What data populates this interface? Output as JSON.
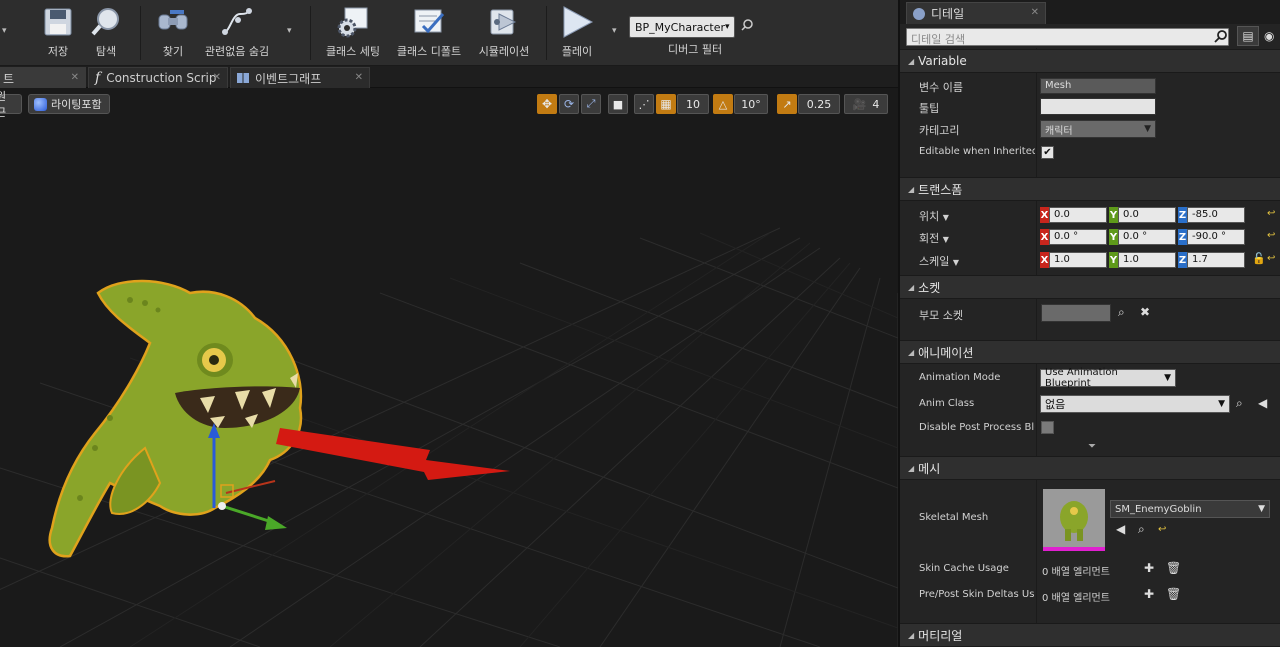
{
  "toolbar": {
    "buttons": [
      {
        "label": "저장",
        "icon": "save-icon"
      },
      {
        "label": "탐색",
        "icon": "browse-icon"
      },
      {
        "label": "찾기",
        "icon": "find-icon"
      },
      {
        "label": "관련없음 숨김",
        "icon": "hide-unrelated-icon"
      },
      {
        "label": "클래스 세팅",
        "icon": "class-settings-icon"
      },
      {
        "label": "클래스 디폴트",
        "icon": "class-defaults-icon"
      },
      {
        "label": "시뮬레이션",
        "icon": "simulation-icon"
      },
      {
        "label": "플레이",
        "icon": "play-icon"
      }
    ],
    "debug_object": "BP_MyCharacter",
    "debug_filter_label": "디버그 필터"
  },
  "tabs": [
    {
      "label": "트"
    },
    {
      "label": "Construction Scrip"
    },
    {
      "label": "이벤트그래프"
    }
  ],
  "viewport": {
    "left_pills": [
      "원근",
      "라이팅포함"
    ],
    "grid_snap": "10",
    "rotation_snap": "10°",
    "scale_snap": "0.25",
    "camera_speed": "4"
  },
  "panel": {
    "tab_label": "디테일",
    "search_placeholder": "디테일 검색",
    "variable": {
      "header": "Variable",
      "name_label": "변수 이름",
      "name_value": "Mesh",
      "tooltip_label": "툴팁",
      "category_label": "카테고리",
      "category_value": "캐릭터",
      "editable_label": "Editable when Inherited"
    },
    "transform": {
      "header": "트랜스폼",
      "location_label": "위치",
      "location": [
        "0.0",
        "0.0",
        "-85.0"
      ],
      "rotation_label": "회전",
      "rotation": [
        "0.0 °",
        "0.0 °",
        "-90.0 °"
      ],
      "scale_label": "스케일",
      "scale": [
        "1.0",
        "1.0",
        "1.7"
      ]
    },
    "socket": {
      "header": "소켓",
      "parent_label": "부모 소켓"
    },
    "animation": {
      "header": "애니메이션",
      "mode_label": "Animation Mode",
      "mode_value": "Use Animation Blueprint",
      "class_label": "Anim Class",
      "class_value": "없음",
      "disable_pp_label": "Disable Post Process Blu"
    },
    "mesh": {
      "header": "메시",
      "skeletal_label": "Skeletal Mesh",
      "skeletal_value": "SM_EnemyGoblin",
      "skin_cache_label": "Skin Cache Usage",
      "skin_cache_value": "0 배열 엘리먼트",
      "skin_deltas_label": "Pre/Post Skin Deltas Usa",
      "skin_deltas_value": "0 배열 엘리먼트"
    },
    "material": {
      "header": "머티리얼"
    }
  },
  "colors": {
    "toolbar_bg": "#2d2d2d",
    "viewport_bg": "#1a1a1a",
    "panel_bg": "#242424",
    "snap_orange": "#c27b12",
    "axis_x": "#c8261d",
    "axis_y": "#5e9a1a",
    "axis_z": "#2a6fc9"
  }
}
